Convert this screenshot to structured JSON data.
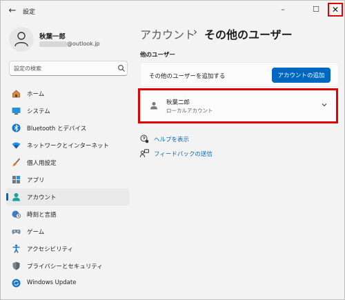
{
  "window": {
    "title": "設定",
    "back": "←",
    "minimize": "–",
    "maximize": "☐",
    "close": "✕"
  },
  "account": {
    "name": "秋葉一郎",
    "email_suffix": "@outlook.jp"
  },
  "search": {
    "placeholder": "設定の検索"
  },
  "sidebar": {
    "items": [
      {
        "label": "ホーム",
        "icon": "home-icon",
        "active": false
      },
      {
        "label": "システム",
        "icon": "monitor-icon",
        "active": false
      },
      {
        "label": "Bluetooth とデバイス",
        "icon": "bluetooth-icon",
        "active": false
      },
      {
        "label": "ネットワークとインターネット",
        "icon": "wifi-icon",
        "active": false
      },
      {
        "label": "個人用設定",
        "icon": "brush-icon",
        "active": false
      },
      {
        "label": "アプリ",
        "icon": "apps-icon",
        "active": false
      },
      {
        "label": "アカウント",
        "icon": "account-icon",
        "active": true
      },
      {
        "label": "時刻と言語",
        "icon": "globe-clock-icon",
        "active": false
      },
      {
        "label": "ゲーム",
        "icon": "gamepad-icon",
        "active": false
      },
      {
        "label": "アクセシビリティ",
        "icon": "accessibility-icon",
        "active": false
      },
      {
        "label": "プライバシーとセキュリティ",
        "icon": "shield-icon",
        "active": false
      },
      {
        "label": "Windows Update",
        "icon": "update-icon",
        "active": false
      }
    ]
  },
  "main": {
    "breadcrumb_parent": "アカウント",
    "breadcrumb_sep": "›",
    "breadcrumb_current": "その他のユーザー",
    "section_title": "他のユーザー",
    "add_user": {
      "label": "その他のユーザーを追加する",
      "button": "アカウントの追加"
    },
    "user_card": {
      "name": "秋葉二郎",
      "subtitle": "ローカルアカウント"
    },
    "links": {
      "help": "ヘルプを表示",
      "feedback": "フィードバックの送信"
    }
  },
  "colors": {
    "accent": "#0067c0",
    "highlight": "#e00000",
    "background": "#f3f3f3"
  }
}
